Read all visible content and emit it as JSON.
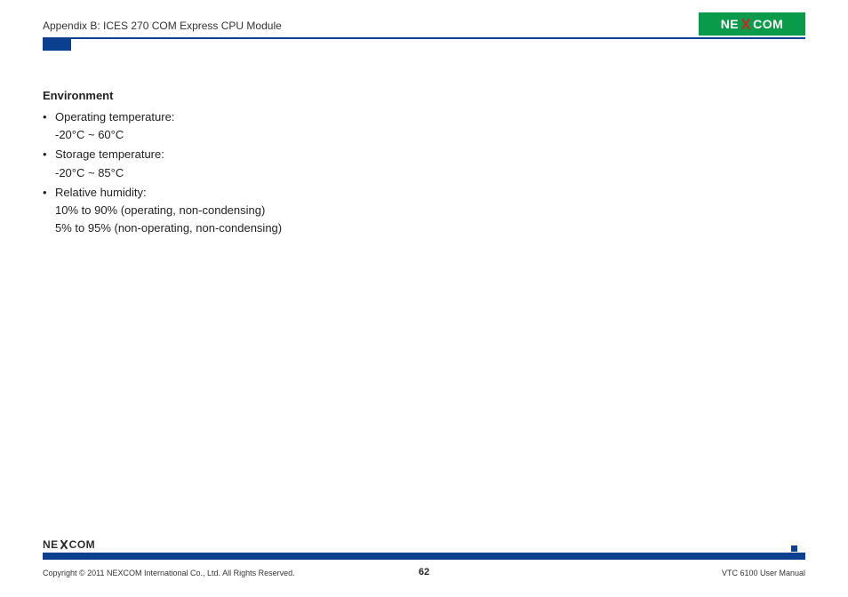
{
  "header": {
    "title": "Appendix B: ICES 270 COM Express CPU Module",
    "brand_pre": "NE",
    "brand_post": "COM"
  },
  "content": {
    "section_heading": "Environment",
    "items": [
      {
        "label": "Operating temperature:",
        "lines": [
          "-20°C ~ 60°C"
        ]
      },
      {
        "label": "Storage temperature:",
        "lines": [
          "-20°C ~ 85°C"
        ]
      },
      {
        "label": "Relative humidity:",
        "lines": [
          "10% to 90% (operating, non-condensing)",
          "5% to 95% (non-operating, non-condensing)"
        ]
      }
    ]
  },
  "footer": {
    "brand_pre": "NE",
    "brand_post": "COM",
    "copyright": "Copyright © 2011 NEXCOM International Co., Ltd. All Rights Reserved.",
    "page_number": "62",
    "doc_title": "VTC 6100 User Manual"
  }
}
